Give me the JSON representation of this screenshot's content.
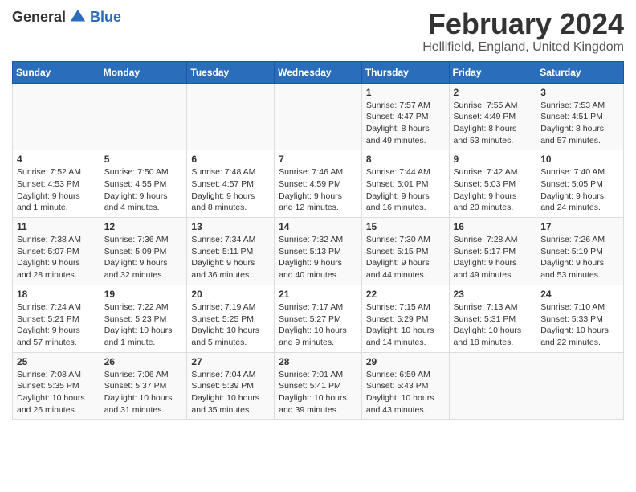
{
  "logo": {
    "general": "General",
    "blue": "Blue"
  },
  "title": "February 2024",
  "subtitle": "Hellifield, England, United Kingdom",
  "days_header": [
    "Sunday",
    "Monday",
    "Tuesday",
    "Wednesday",
    "Thursday",
    "Friday",
    "Saturday"
  ],
  "weeks": [
    [
      {
        "day": "",
        "info": ""
      },
      {
        "day": "",
        "info": ""
      },
      {
        "day": "",
        "info": ""
      },
      {
        "day": "",
        "info": ""
      },
      {
        "day": "1",
        "info": "Sunrise: 7:57 AM\nSunset: 4:47 PM\nDaylight: 8 hours\nand 49 minutes."
      },
      {
        "day": "2",
        "info": "Sunrise: 7:55 AM\nSunset: 4:49 PM\nDaylight: 8 hours\nand 53 minutes."
      },
      {
        "day": "3",
        "info": "Sunrise: 7:53 AM\nSunset: 4:51 PM\nDaylight: 8 hours\nand 57 minutes."
      }
    ],
    [
      {
        "day": "4",
        "info": "Sunrise: 7:52 AM\nSunset: 4:53 PM\nDaylight: 9 hours\nand 1 minute."
      },
      {
        "day": "5",
        "info": "Sunrise: 7:50 AM\nSunset: 4:55 PM\nDaylight: 9 hours\nand 4 minutes."
      },
      {
        "day": "6",
        "info": "Sunrise: 7:48 AM\nSunset: 4:57 PM\nDaylight: 9 hours\nand 8 minutes."
      },
      {
        "day": "7",
        "info": "Sunrise: 7:46 AM\nSunset: 4:59 PM\nDaylight: 9 hours\nand 12 minutes."
      },
      {
        "day": "8",
        "info": "Sunrise: 7:44 AM\nSunset: 5:01 PM\nDaylight: 9 hours\nand 16 minutes."
      },
      {
        "day": "9",
        "info": "Sunrise: 7:42 AM\nSunset: 5:03 PM\nDaylight: 9 hours\nand 20 minutes."
      },
      {
        "day": "10",
        "info": "Sunrise: 7:40 AM\nSunset: 5:05 PM\nDaylight: 9 hours\nand 24 minutes."
      }
    ],
    [
      {
        "day": "11",
        "info": "Sunrise: 7:38 AM\nSunset: 5:07 PM\nDaylight: 9 hours\nand 28 minutes."
      },
      {
        "day": "12",
        "info": "Sunrise: 7:36 AM\nSunset: 5:09 PM\nDaylight: 9 hours\nand 32 minutes."
      },
      {
        "day": "13",
        "info": "Sunrise: 7:34 AM\nSunset: 5:11 PM\nDaylight: 9 hours\nand 36 minutes."
      },
      {
        "day": "14",
        "info": "Sunrise: 7:32 AM\nSunset: 5:13 PM\nDaylight: 9 hours\nand 40 minutes."
      },
      {
        "day": "15",
        "info": "Sunrise: 7:30 AM\nSunset: 5:15 PM\nDaylight: 9 hours\nand 44 minutes."
      },
      {
        "day": "16",
        "info": "Sunrise: 7:28 AM\nSunset: 5:17 PM\nDaylight: 9 hours\nand 49 minutes."
      },
      {
        "day": "17",
        "info": "Sunrise: 7:26 AM\nSunset: 5:19 PM\nDaylight: 9 hours\nand 53 minutes."
      }
    ],
    [
      {
        "day": "18",
        "info": "Sunrise: 7:24 AM\nSunset: 5:21 PM\nDaylight: 9 hours\nand 57 minutes."
      },
      {
        "day": "19",
        "info": "Sunrise: 7:22 AM\nSunset: 5:23 PM\nDaylight: 10 hours\nand 1 minute."
      },
      {
        "day": "20",
        "info": "Sunrise: 7:19 AM\nSunset: 5:25 PM\nDaylight: 10 hours\nand 5 minutes."
      },
      {
        "day": "21",
        "info": "Sunrise: 7:17 AM\nSunset: 5:27 PM\nDaylight: 10 hours\nand 9 minutes."
      },
      {
        "day": "22",
        "info": "Sunrise: 7:15 AM\nSunset: 5:29 PM\nDaylight: 10 hours\nand 14 minutes."
      },
      {
        "day": "23",
        "info": "Sunrise: 7:13 AM\nSunset: 5:31 PM\nDaylight: 10 hours\nand 18 minutes."
      },
      {
        "day": "24",
        "info": "Sunrise: 7:10 AM\nSunset: 5:33 PM\nDaylight: 10 hours\nand 22 minutes."
      }
    ],
    [
      {
        "day": "25",
        "info": "Sunrise: 7:08 AM\nSunset: 5:35 PM\nDaylight: 10 hours\nand 26 minutes."
      },
      {
        "day": "26",
        "info": "Sunrise: 7:06 AM\nSunset: 5:37 PM\nDaylight: 10 hours\nand 31 minutes."
      },
      {
        "day": "27",
        "info": "Sunrise: 7:04 AM\nSunset: 5:39 PM\nDaylight: 10 hours\nand 35 minutes."
      },
      {
        "day": "28",
        "info": "Sunrise: 7:01 AM\nSunset: 5:41 PM\nDaylight: 10 hours\nand 39 minutes."
      },
      {
        "day": "29",
        "info": "Sunrise: 6:59 AM\nSunset: 5:43 PM\nDaylight: 10 hours\nand 43 minutes."
      },
      {
        "day": "",
        "info": ""
      },
      {
        "day": "",
        "info": ""
      }
    ]
  ]
}
